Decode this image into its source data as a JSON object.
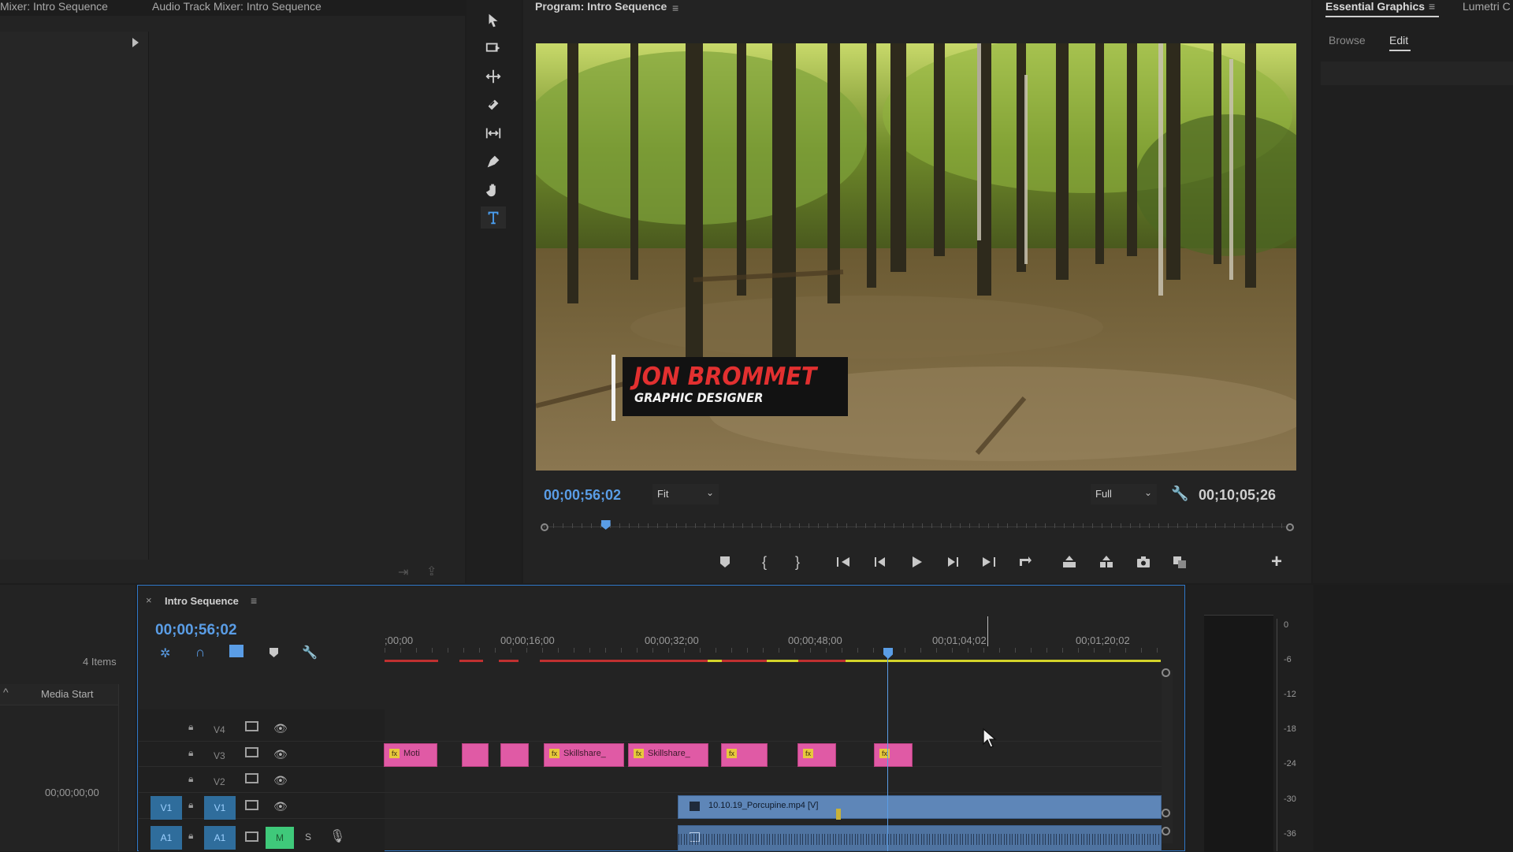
{
  "tabs": {
    "mixer": "Mixer: Intro Sequence",
    "audio_mixer": "Audio Track Mixer: Intro Sequence",
    "program": "Program: Intro Sequence",
    "essential_graphics": "Essential Graphics",
    "lumetri": "Lumetri C"
  },
  "essential_graphics": {
    "browse": "Browse",
    "edit": "Edit"
  },
  "program": {
    "current_timecode": "00;00;56;02",
    "fit": "Fit",
    "quality": "Full",
    "duration": "00;10;05;26",
    "lower_third_name": "JON BROMMET",
    "lower_third_title": "GRAPHIC DESIGNER",
    "playhead_fraction": 0.083
  },
  "project": {
    "items": "4 Items",
    "media_start_header": "Media Start",
    "media_start_value": "00;00;00;00"
  },
  "timeline": {
    "sequence_name": "Intro Sequence",
    "timecode": "00;00;56;02",
    "ruler": [
      ";00;00",
      "00;00;16;00",
      "00;00;32;00",
      "00;00;48;00",
      "00;01;04;02",
      "00;01;20;02"
    ],
    "tracks": {
      "v4": "V4",
      "v3": "V3",
      "v2": "V2",
      "v1_src": "V1",
      "v1": "V1",
      "a1_src": "A1",
      "a1": "A1",
      "m": "M",
      "s": "S"
    },
    "clips": {
      "c1": "Moti",
      "c4": "Skillshare_",
      "c5": "Skillshare_",
      "video": "10.10.19_Porcupine.mp4 [V]"
    }
  },
  "meters": [
    "0",
    "-6",
    "-12",
    "-18",
    "-24",
    "-30",
    "-36"
  ],
  "colors": {
    "accent_blue": "#5a9de6",
    "clip_pink": "#e05aa5",
    "clip_blue": "#5e86b8",
    "title_red": "#e23030",
    "render_red": "#c03030",
    "render_yellow": "#d4d42a"
  }
}
